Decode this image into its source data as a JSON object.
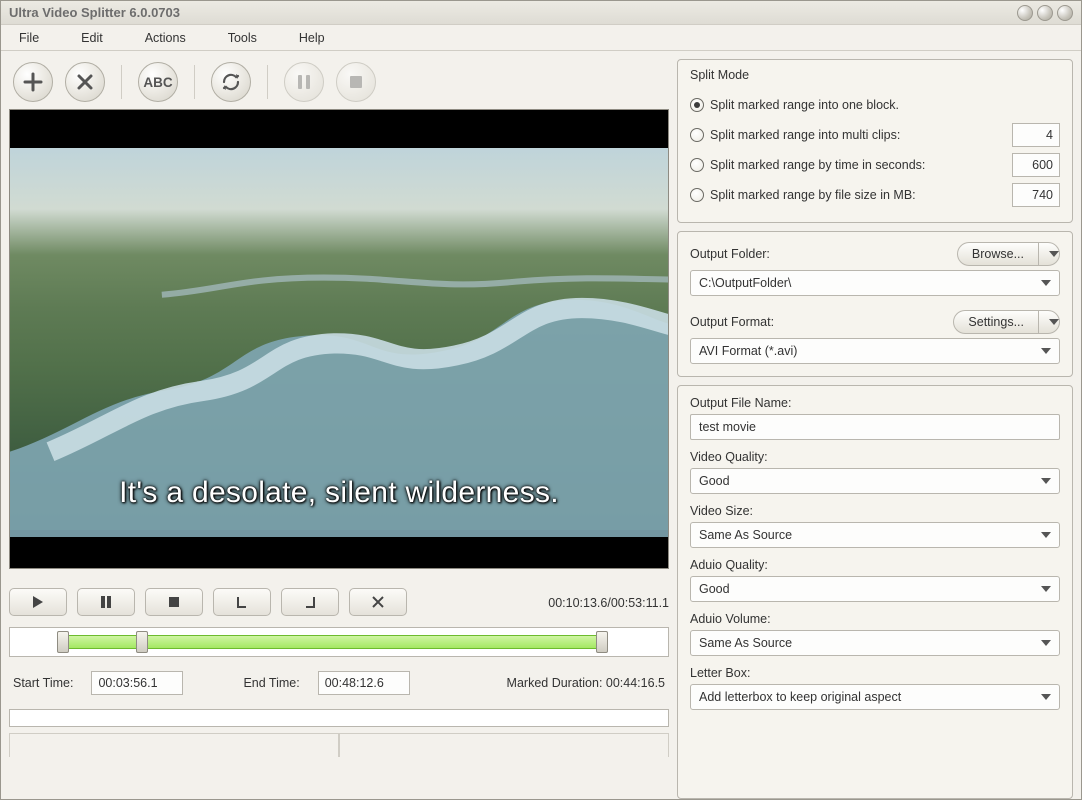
{
  "window": {
    "title": "Ultra Video Splitter 6.0.0703"
  },
  "menu": {
    "file": "File",
    "edit": "Edit",
    "actions": "Actions",
    "tools": "Tools",
    "help": "Help"
  },
  "toolbar": {
    "abc": "ABC"
  },
  "video": {
    "subtitle": "It's a desolate, silent wilderness."
  },
  "playback": {
    "position": "00:10:13.6",
    "duration": "00:53:11.1",
    "sep": "/",
    "start_label": "Start Time:",
    "start_value": "00:03:56.1",
    "end_label": "End Time:",
    "end_value": "00:48:12.6",
    "marked_label": "Marked Duration:",
    "marked_value": "00:44:16.5"
  },
  "split_mode": {
    "title": "Split Mode",
    "opt_block": "Split  marked range into one block.",
    "opt_multi": "Split marked range into multi clips:",
    "opt_time": "Split marked range by time in seconds:",
    "opt_size": "Split marked range by file size in MB:",
    "multi_value": "4",
    "time_value": "600",
    "size_value": "740"
  },
  "output": {
    "folder_label": "Output Folder:",
    "browse": "Browse...",
    "folder_value": "C:\\OutputFolder\\",
    "format_label": "Output Format:",
    "settings": "Settings...",
    "format_value": "AVI Format (*.avi)"
  },
  "settings": {
    "filename_label": "Output File Name:",
    "filename_value": "test movie",
    "vquality_label": "Video Quality:",
    "vquality_value": "Good",
    "vsize_label": "Video Size:",
    "vsize_value": "Same As Source",
    "aquality_label": "Aduio Quality:",
    "aquality_value": "Good",
    "avolume_label": "Aduio Volume:",
    "avolume_value": "Same As Source",
    "letterbox_label": "Letter Box:",
    "letterbox_value": "Add letterbox to keep original aspect"
  }
}
